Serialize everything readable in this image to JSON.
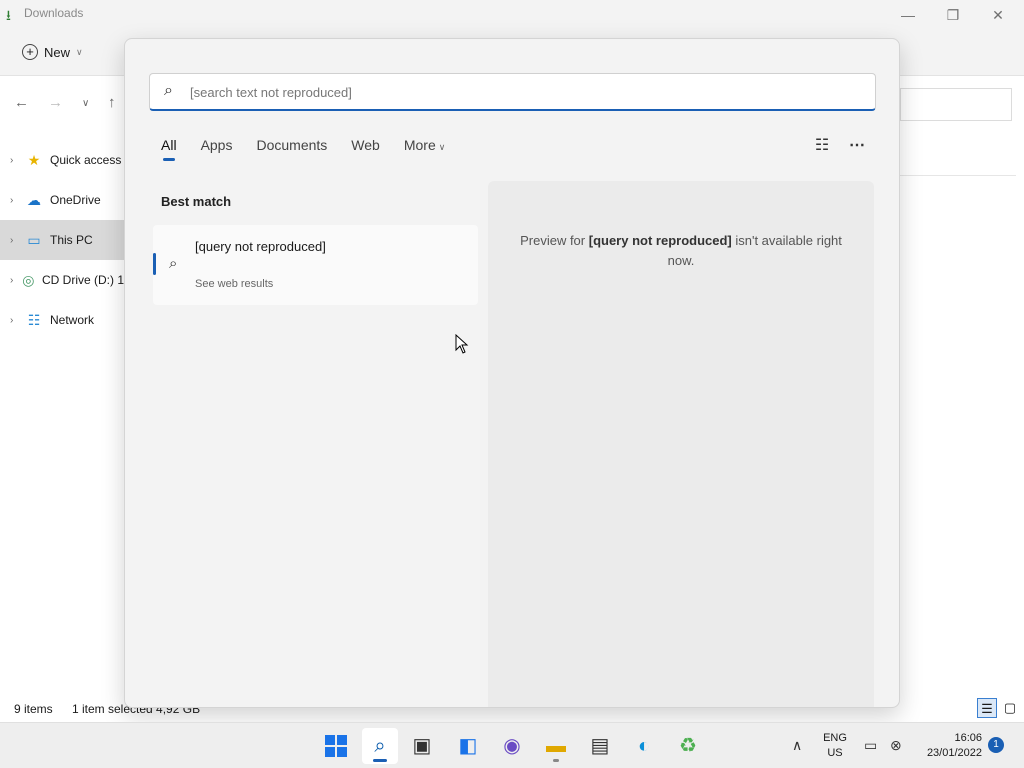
{
  "explorer": {
    "title": "Downloads",
    "toolbar": {
      "new_label": "New"
    },
    "sidebar": [
      {
        "label": "Quick access",
        "icon": "star-icon"
      },
      {
        "label": "OneDrive",
        "icon": "cloud-icon"
      },
      {
        "label": "This PC",
        "icon": "monitor-icon",
        "selected": true
      },
      {
        "label": "CD Drive (D:) 1",
        "icon": "cd-drive-icon"
      },
      {
        "label": "Network",
        "icon": "network-icon"
      }
    ],
    "status": {
      "items": "9 items",
      "selection": "1 item selected  4,92 GB"
    }
  },
  "search": {
    "query": "[search text not reproduced]",
    "tabs": [
      "All",
      "Apps",
      "Documents",
      "Web",
      "More"
    ],
    "active_tab": "All",
    "best_match_heading": "Best match",
    "result": {
      "title": "[query not reproduced]",
      "subtitle": "See web results"
    },
    "preview": {
      "prefix": "Preview for ",
      "query": "[query not reproduced]",
      "suffix": " isn't available right now."
    }
  },
  "taskbar": {
    "apps": [
      "start-icon",
      "search-icon",
      "task-view-icon",
      "widgets-icon",
      "teams-chat-icon",
      "file-explorer-icon",
      "microsoft-store-icon",
      "edge-icon",
      "recycle-icon"
    ],
    "active_app": "search-icon",
    "language": {
      "line1": "ENG",
      "line2": "US"
    },
    "time": "16:06",
    "date": "23/01/2022",
    "notification_count": "1"
  },
  "colors": {
    "accent": "#1a5fb4",
    "flyout_bg": "#f3f3f3",
    "preview_bg": "#ebebeb"
  }
}
